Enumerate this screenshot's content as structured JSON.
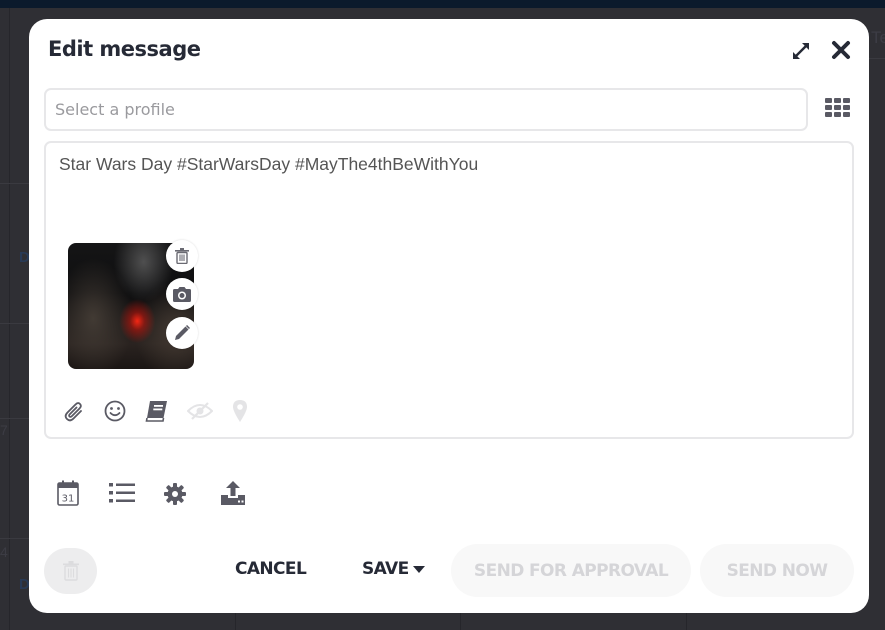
{
  "background": {
    "partial_texts": [
      "Te",
      "D",
      "7",
      "4",
      "D"
    ]
  },
  "modal": {
    "title": "Edit message",
    "expand_icon": "expand-arrows-icon",
    "close_icon": "close-x-icon"
  },
  "profile_select": {
    "placeholder": "Select a profile",
    "value": "",
    "grid_icon": "grid-apps-icon"
  },
  "composer": {
    "message_text": "Star Wars Day #StarWarsDay #MayThe4thBeWithYou",
    "media": {
      "description": "dark cave image with red glowing light",
      "actions": [
        "trash-icon",
        "camera-icon",
        "pencil-icon"
      ]
    },
    "toolbar": [
      {
        "icon": "paperclip-icon",
        "enabled": true
      },
      {
        "icon": "smiley-icon",
        "enabled": true
      },
      {
        "icon": "book-icon",
        "enabled": true
      },
      {
        "icon": "eye-slash-icon",
        "enabled": false
      },
      {
        "icon": "map-pin-icon",
        "enabled": false
      }
    ]
  },
  "options_bar": [
    {
      "icon": "calendar-icon",
      "label": "31"
    },
    {
      "icon": "list-icon"
    },
    {
      "icon": "gear-icon"
    },
    {
      "icon": "upload-icon"
    }
  ],
  "footer": {
    "delete_icon": "trash-icon",
    "cancel_label": "CANCEL",
    "save_label": "SAVE",
    "send_for_approval_label": "SEND FOR APPROVAL",
    "send_now_label": "SEND NOW"
  },
  "colors": {
    "text_dark": "#262a36",
    "icon_gray": "#5a5a64",
    "disabled_text": "#d5d5d8",
    "disabled_bg": "#f8f8f8",
    "overlay_bg": "#2f2f34",
    "top_bar": "#0b1a2c"
  }
}
